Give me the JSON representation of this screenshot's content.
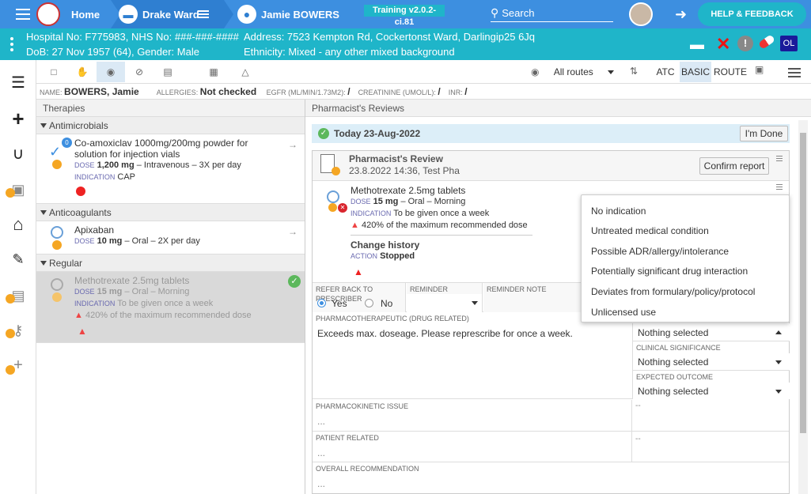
{
  "topbar": {
    "home_label": "Home",
    "ward_label": "Drake Ward",
    "patient_label": "Jamie BOWERS",
    "version": "Training v2.0.2-ci.81",
    "search_label": "Search",
    "help_label": "HELP & FEEDBACK"
  },
  "patient": {
    "hospital_no": "Hospital No: F775983, NHS No: ###-###-####",
    "dob": "DoB: 27 Nov 1957 (64), Gender: Male",
    "address": "Address: 7523 Kempton Rd, Cockertonst Ward, Darlingip25 6Jq",
    "ethnicity": "Ethnicity: Mixed - any other mixed background",
    "ol_badge": "OL"
  },
  "toolbar": {
    "routes_label": "All routes",
    "atc_label": "ATC",
    "basic_label": "BASIC",
    "route_label": "ROUTE"
  },
  "pinfo": {
    "name_label": "NAME:",
    "name_value": "BOWERS, Jamie",
    "allergies_label": "ALLERGIES:",
    "allergies_value": "Not checked",
    "egfr_label": "EGFR (ML/MIN/1.73M2):",
    "egfr_value": "/",
    "creat_label": "CREATININE (UMOL/L):",
    "creat_value": "/",
    "inr_label": "INR:",
    "inr_value": "/"
  },
  "therapies": {
    "header": "Therapies",
    "groups": [
      {
        "name": "Antimicrobials"
      },
      {
        "name": "Anticoagulants"
      },
      {
        "name": "Regular"
      }
    ],
    "drug1": {
      "name": "Co-amoxiclav 1000mg/200mg powder for solution for injection vials",
      "dose_label": "DOSE",
      "dose": "1,200 mg",
      "dose_rest": "– Intravenous – 3X per day",
      "ind_label": "INDICATION",
      "ind": "CAP",
      "badge": "0"
    },
    "drug2": {
      "name": "Apixaban",
      "dose_label": "DOSE",
      "dose": "10 mg",
      "dose_rest": "– Oral – 2X per day"
    },
    "drug3": {
      "name": "Methotrexate 2.5mg tablets",
      "dose_label": "DOSE",
      "dose": "15 mg",
      "dose_rest": "– Oral – Morning",
      "ind_label": "INDICATION",
      "ind": "To be given once a week",
      "warning": "420% of the maximum recommended dose"
    }
  },
  "reviews": {
    "header": "Pharmacist's Reviews",
    "date": "Today 23-Aug-2022",
    "done_label": "I'm Done",
    "review_title": "Pharmacist's Review",
    "review_sub": "23.8.2022 14:36, Test Pha",
    "confirm_label": "Confirm report",
    "drug_name": "Methotrexate 2.5mg tablets",
    "dose_label": "DOSE",
    "dose": "15 mg",
    "dose_rest": "– Oral – Morning",
    "ind_label": "INDICATION",
    "ind": "To be given once a week",
    "warning": "420% of the maximum recommended dose",
    "change_history": "Change history",
    "action_label": "ACTION",
    "action": "Stopped",
    "refer_label": "REFER BACK TO PRESCRIBER",
    "yes": "Yes",
    "no": "No",
    "reminder_label": "REMINDER",
    "reminder_note_label": "REMINDER NOTE",
    "pharmaco_label": "PHARMACOTHERAPEUTIC (DRUG RELATED)",
    "pharmaco_text": "Exceeds max. doseage. Please represcribe for once a week.",
    "nothing1": "Nothing selected",
    "clin_label": "CLINICAL SIGNIFICANCE",
    "nothing2": "Nothing selected",
    "expected_label": "EXPECTED OUTCOME",
    "nothing3": "Nothing selected",
    "pk_label": "PHARMACOKINETIC ISSUE",
    "pk_val": "...",
    "pk_right": "--",
    "pr_label": "PATIENT RELATED",
    "pr_val": "...",
    "pr_right": "--",
    "or_label": "OVERALL RECOMMENDATION",
    "or_val": "..."
  },
  "dropdown": {
    "options": [
      "No indication",
      "Untreated medical condition",
      "Possible ADR/allergy/intolerance",
      "Potentially significant drug interaction",
      "Deviates from formulary/policy/protocol",
      "Unlicensed use"
    ]
  }
}
